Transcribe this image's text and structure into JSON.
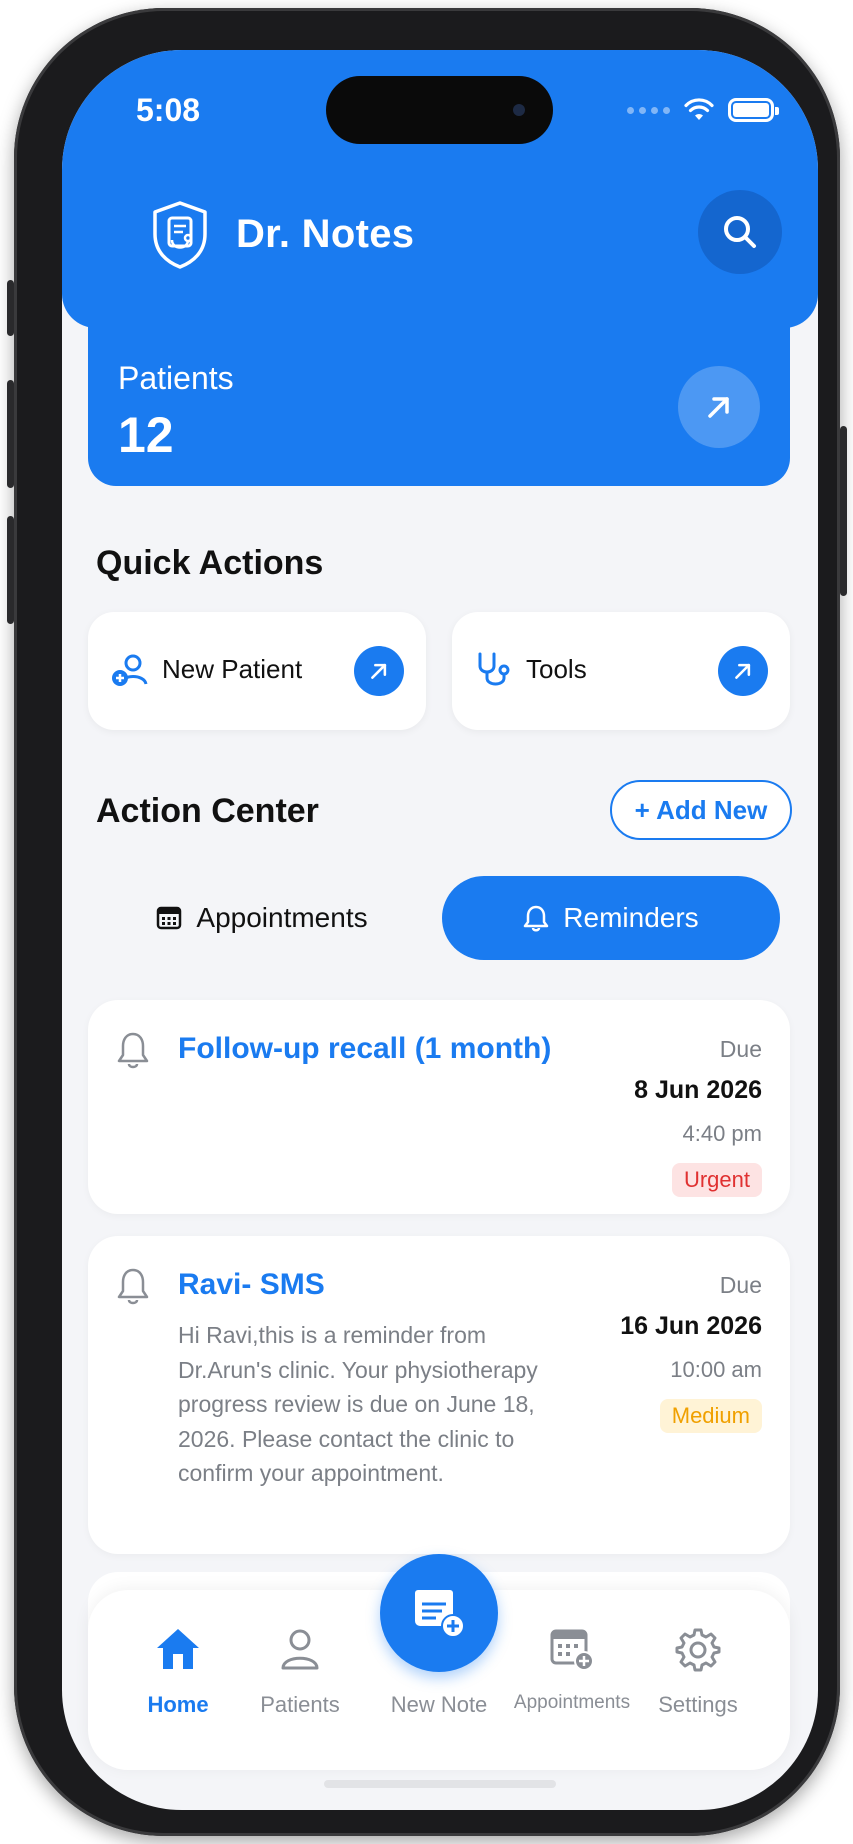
{
  "status_bar": {
    "time": "5:08"
  },
  "header": {
    "title": "Dr. Notes",
    "logo_icon": "shield-stethoscope-icon",
    "search_icon": "search-icon"
  },
  "patients_card": {
    "label": "Patients",
    "count": "12"
  },
  "quick_actions": {
    "title": "Quick Actions",
    "items": [
      {
        "label": "New Patient",
        "icon": "add-user-icon"
      },
      {
        "label": "Tools",
        "icon": "stethoscope-icon"
      }
    ]
  },
  "action_center": {
    "title": "Action Center",
    "add_new_label": "+ Add New",
    "tabs": [
      {
        "label": "Appointments",
        "icon": "calendar-icon",
        "active": false
      },
      {
        "label": "Reminders",
        "icon": "bell-icon",
        "active": true
      }
    ]
  },
  "reminders": [
    {
      "title": "Follow-up recall (1 month)",
      "body": "",
      "due_label": "Due",
      "date": "8 Jun 2026",
      "time": "4:40 pm",
      "priority": "Urgent",
      "priority_color": "#e03131"
    },
    {
      "title": "Ravi- SMS",
      "body": "Hi Ravi,this is a reminder from Dr.Arun's clinic. Your physiotherapy progress review is due on June 18, 2026. Please contact the clinic to confirm your appointment.",
      "due_label": "Due",
      "date": "16 Jun 2026",
      "time": "10:00 am",
      "priority": "Medium",
      "priority_color": "#f0a000"
    }
  ],
  "bottom_nav": {
    "items": [
      {
        "label": "Home",
        "icon": "home-icon",
        "active": true
      },
      {
        "label": "Patients",
        "icon": "user-icon",
        "active": false
      },
      {
        "label": "New Note",
        "icon": "new-note-icon",
        "active": false
      },
      {
        "label": "Appointments",
        "icon": "calendar-add-icon",
        "active": false
      },
      {
        "label": "Settings",
        "icon": "gear-icon",
        "active": false
      }
    ]
  },
  "colors": {
    "primary": "#1a7bf0",
    "background": "#f4f5f8",
    "urgent": "#e03131",
    "medium": "#f0a000"
  }
}
